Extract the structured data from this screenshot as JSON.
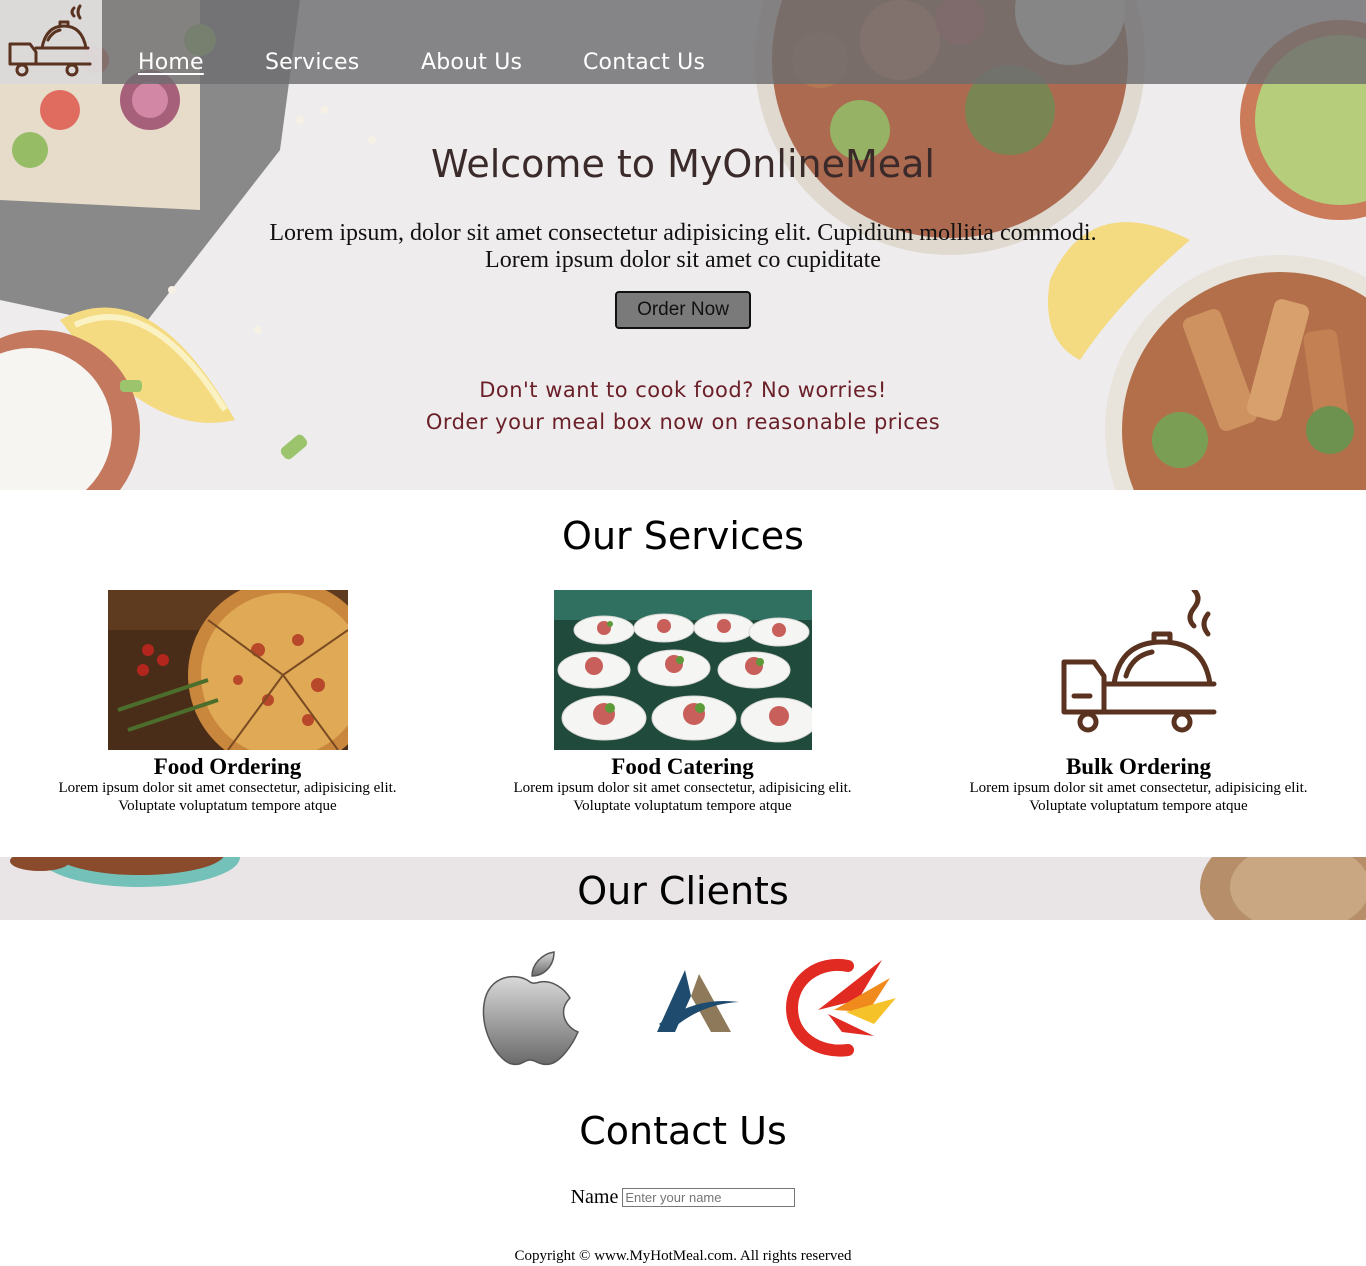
{
  "nav": {
    "items": [
      {
        "label": "Home",
        "active": true
      },
      {
        "label": "Services",
        "active": false
      },
      {
        "label": "About Us",
        "active": false
      },
      {
        "label": "Contact Us",
        "active": false
      }
    ],
    "logo_icon": "delivery-truck-cloche-icon"
  },
  "hero": {
    "title": "Welcome to MyOnlineMeal",
    "text_line1": "Lorem ipsum, dolor sit amet consectetur adipisicing elit. Cupidium mollitia commodi.",
    "text_line2": "Lorem ipsum dolor sit amet co cupiditate",
    "cta_label": "Order Now",
    "tagline1": "Don't want to cook food? No worries!",
    "tagline2": "Order your meal box now on reasonable prices"
  },
  "services": {
    "title": "Our Services",
    "items": [
      {
        "name": "Food Ordering",
        "desc1": "Lorem ipsum dolor sit amet consectetur, adipisicing elit.",
        "desc2": "Voluptate voluptatum tempore atque",
        "image": "pizza-photo"
      },
      {
        "name": "Food Catering",
        "desc1": "Lorem ipsum dolor sit amet consectetur, adipisicing elit.",
        "desc2": "Voluptate voluptatum tempore atque",
        "image": "catering-plates-photo"
      },
      {
        "name": "Bulk Ordering",
        "desc1": "Lorem ipsum dolor sit amet consectetur, adipisicing elit.",
        "desc2": "Voluptate voluptatum tempore atque",
        "image": "delivery-truck-icon"
      }
    ]
  },
  "clients": {
    "title": "Our Clients",
    "logos": [
      "apple-logo",
      "a-mountain-logo",
      "red-bird-logo"
    ]
  },
  "contact": {
    "title": "Contact Us",
    "name_label": "Name",
    "name_placeholder": "Enter your name"
  },
  "footer": {
    "copyright": "Copyright © www.MyHotMeal.com. All rights reserved"
  },
  "colors": {
    "nav_bg": "#6e6e70",
    "tagline": "#6b1f28",
    "brand_brown": "#5a3220",
    "button_bg": "#7a7a7a"
  }
}
